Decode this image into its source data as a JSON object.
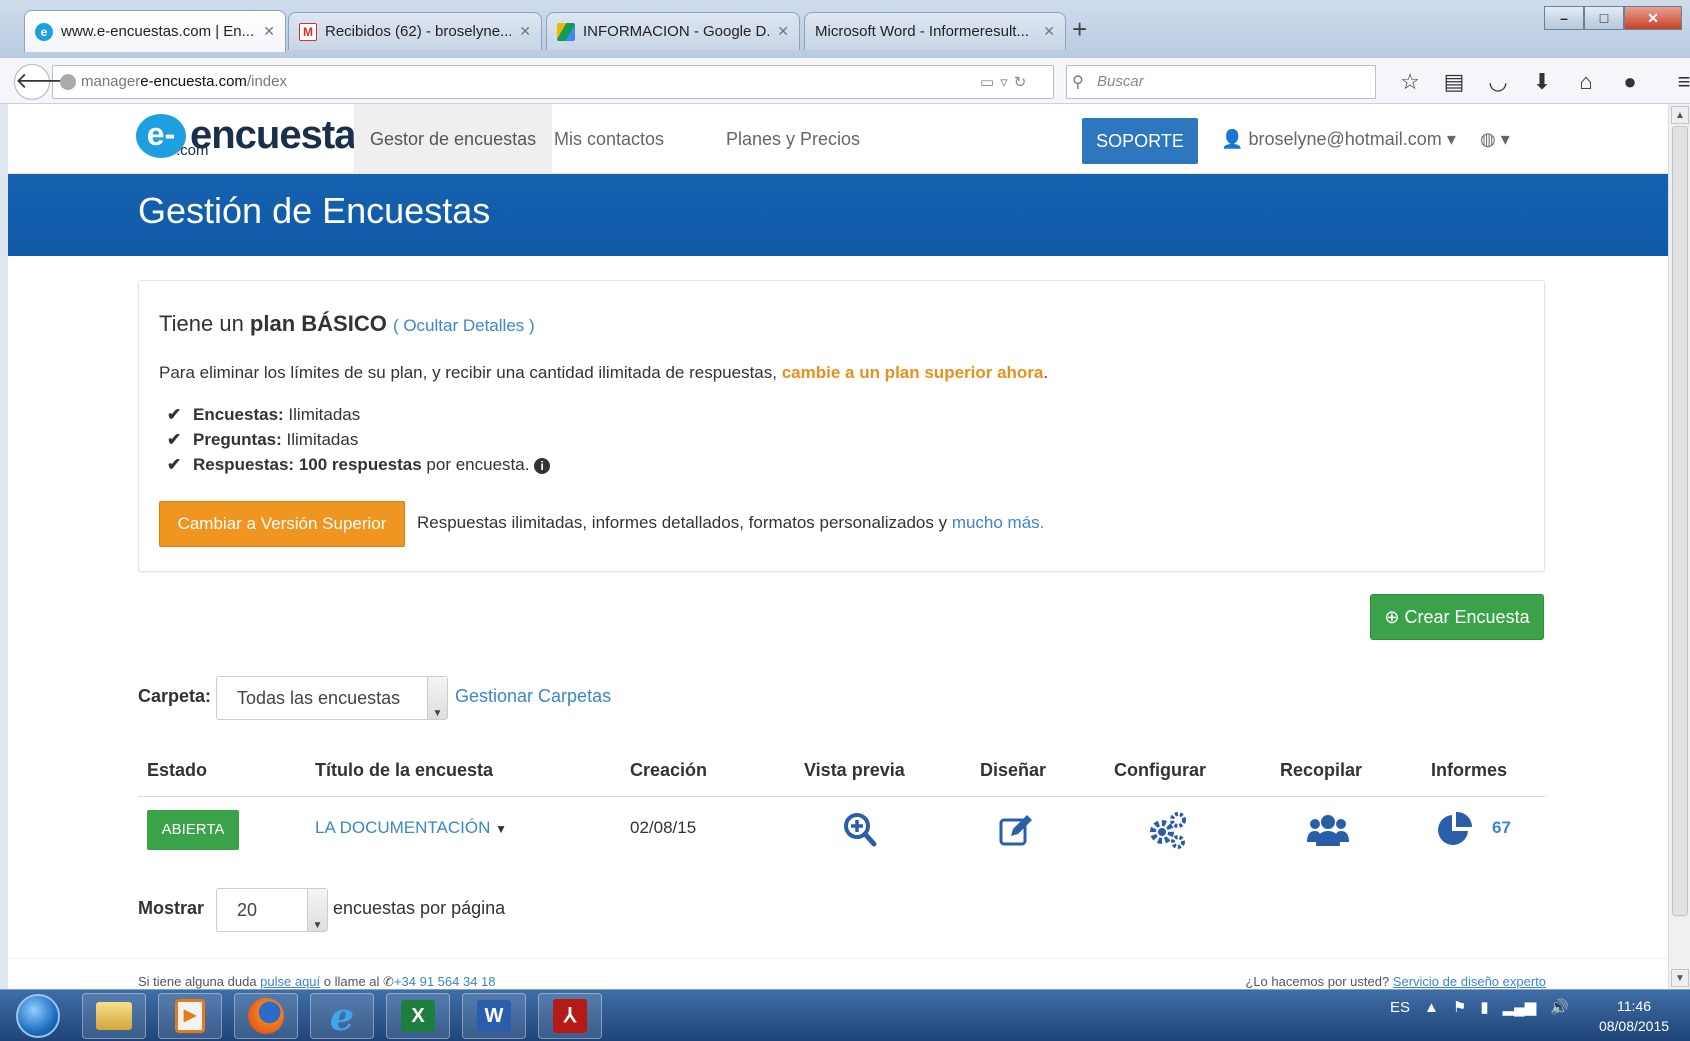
{
  "browser": {
    "tabs": [
      {
        "label": "www.e-encuestas.com | En...",
        "active": true,
        "icon": "e-encuesta-favicon"
      },
      {
        "label": "Recibidos (62) - broselyne...",
        "active": false,
        "icon": "gmail-icon"
      },
      {
        "label": "INFORMACION - Google D...",
        "active": false,
        "icon": "google-drive-icon"
      },
      {
        "label": "Microsoft Word - Informeresult...",
        "active": false,
        "icon": ""
      }
    ],
    "new_tab": "+",
    "url_prefix": "manager",
    "url_domain": "e-encuesta.com",
    "url_path": "/index",
    "search_placeholder": "Buscar"
  },
  "site": {
    "logo_text": "encuesta",
    "logo_e": "e-",
    "logo_com": ".com",
    "nav": [
      {
        "label": "Gestor de encuestas",
        "active": true
      },
      {
        "label": "Mis contactos",
        "active": false
      },
      {
        "label": "Planes y Precios",
        "active": false
      }
    ],
    "support_label": "SOPORTE",
    "user_email": "broselyne@hotmail.com"
  },
  "hero": {
    "title": "Gestión de Encuestas"
  },
  "plan": {
    "title_prefix": "Tiene un ",
    "title_plan": "plan BÁSICO",
    "hide_details": "( Ocultar Detalles )",
    "description": "Para eliminar los límites de su plan, y recibir una cantidad ilimitada de respuestas, ",
    "description_link": "cambie a un plan superior ahora",
    "description_end": ".",
    "features": [
      {
        "label": "Encuestas:",
        "value": " Ilimitadas"
      },
      {
        "label": "Preguntas:",
        "value": " Ilimitadas"
      },
      {
        "label": "Respuestas: 100 respuestas",
        "value": " por encuesta."
      }
    ],
    "upgrade_button": "Cambiar a Versión Superior",
    "upgrade_text": "Respuestas ilimitadas, informes detallados, formatos personalizados y ",
    "upgrade_link": "mucho más."
  },
  "actions": {
    "create_survey": "Crear Encuesta"
  },
  "filter": {
    "folder_label": "Carpeta:",
    "folder_value": "Todas las encuestas",
    "manage_folders": "Gestionar Carpetas"
  },
  "table": {
    "headers": [
      "Estado",
      "Título de la encuesta",
      "Creación",
      "Vista previa",
      "Diseñar",
      "Configurar",
      "Recopilar",
      "Informes"
    ],
    "rows": [
      {
        "status": "ABIERTA",
        "title": "LA DOCUMENTACIÓN",
        "created": "02/08/15",
        "report_count": "67"
      }
    ]
  },
  "pagination": {
    "show_label": "Mostrar",
    "per_page": "20",
    "suffix": "encuestas por página"
  },
  "footer": {
    "left_prefix": "Si tiene alguna duda ",
    "left_link": "pulse aquí",
    "left_mid": " o llame al ",
    "phone": "+34 91 564 34 18",
    "right_prefix": "¿Lo hacemos por usted? ",
    "right_link": "Servicio de diseño experto"
  },
  "taskbar": {
    "language": "ES",
    "time": "11:46",
    "date": "08/08/2015"
  },
  "colors": {
    "brand_blue": "#1662b0",
    "link_blue": "#3b87c8",
    "orange": "#f0951f",
    "green": "#3aa34a"
  }
}
